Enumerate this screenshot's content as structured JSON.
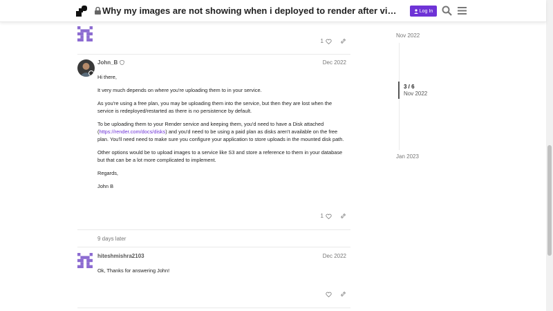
{
  "header": {
    "title": "Why my images are not showing when i deployed to render after visiting the site",
    "login_label": "Log In"
  },
  "posts": [
    {
      "likes": "1"
    },
    {
      "username": "John_B",
      "date": "Dec 2022",
      "paragraphs": [
        "Hi there,",
        "It very much depends on where you're uploading them to in your service.",
        "As you're using a free plan, you may be uploading them into the service, but then they are lost when the service is redeployed/restarted as there is no persistence by default.",
        "Other options would be to upload images to a service like S3 and store a reference to them in your database but that can be a lot more complicated to implement.",
        "Regards,",
        "John B"
      ],
      "disk_before": "To be uploading them to your Render service and keeping them, you'd need to have a Disk attached (",
      "disk_link": "https://render.com/docs/disks",
      "disk_after": ") and you'd need to be using a paid plan as disks aren't available on the free plan. You'll need need to make sure you configure your application to store uploads in the mounted disk path.",
      "likes": "1"
    },
    {
      "username": "hiteshmishra2103",
      "date": "Dec 2022",
      "text": "Ok, Thanks for answering John!"
    }
  ],
  "gap_label": "9 days later",
  "timeline": {
    "start": "Nov 2022",
    "position": "3 / 6",
    "current_date": "Nov 2022",
    "end": "Jan 2023"
  },
  "colors": {
    "accent": "#6e33d6"
  }
}
